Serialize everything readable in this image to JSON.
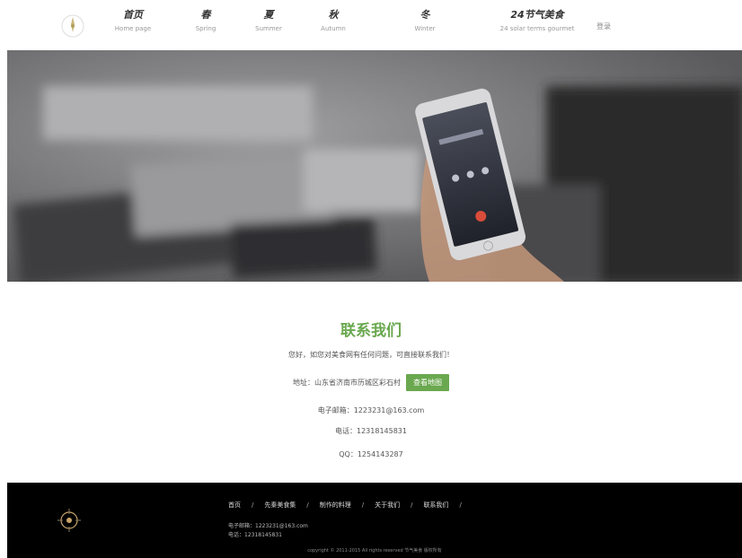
{
  "nav": {
    "items": [
      {
        "cn": "首页",
        "en": "Home page"
      },
      {
        "cn": "春",
        "en": "Spring"
      },
      {
        "cn": "夏",
        "en": "Summer"
      },
      {
        "cn": "秋",
        "en": "Autumn"
      },
      {
        "cn": "冬",
        "en": "Winter"
      },
      {
        "cn": "24节气美食",
        "en": "24 solar terms gourmet"
      }
    ],
    "login": "登录"
  },
  "contact": {
    "title": "联系我们",
    "intro": "您好，如您对美食网有任何问题，可直接联系我们！",
    "address_label": "地址：山东省济南市历城区彩石村",
    "map_button": "查看地图",
    "email": "电子邮箱：1223231@163.com",
    "phone": "电话：12318145831",
    "qq": "QQ：1254143287"
  },
  "footer": {
    "nav": [
      "首页",
      "先秦美食集",
      "制作的料理",
      "关于我们",
      "联系我们"
    ],
    "email": "电子邮箱：1223231@163.com",
    "phone": "电话：12318145831",
    "copyright": "copyright © 2011-2015 All rights reserved 节气美食 版权所有"
  },
  "colors": {
    "accent": "#6aa84f",
    "footer_bg": "#000000"
  }
}
